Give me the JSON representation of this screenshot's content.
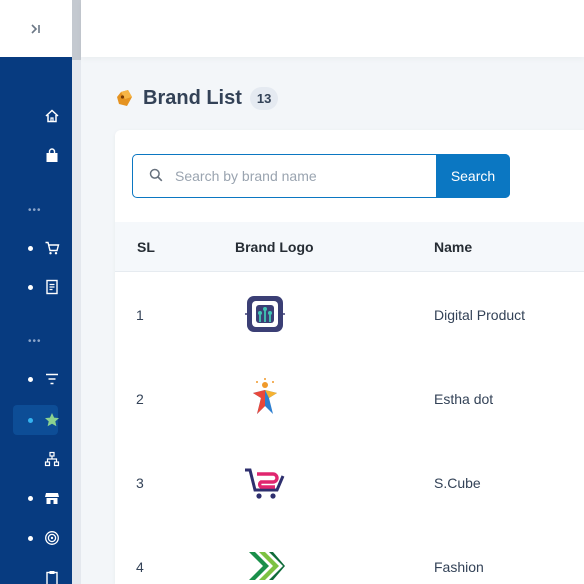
{
  "sidebar": {
    "collapse_icon": "collapse-right-icon",
    "items": [
      {
        "name": "home",
        "icon": "home-icon",
        "active": false
      },
      {
        "name": "bag",
        "icon": "bag-icon",
        "active": false
      },
      {
        "name": "cart",
        "icon": "cart-icon",
        "active": false
      },
      {
        "name": "orders",
        "icon": "document-icon",
        "active": false
      },
      {
        "name": "filter",
        "icon": "filter-icon",
        "active": false
      },
      {
        "name": "brands",
        "icon": "star-icon",
        "active": true
      },
      {
        "name": "categories",
        "icon": "hierarchy-icon",
        "active": false
      },
      {
        "name": "store",
        "icon": "store-icon",
        "active": false
      },
      {
        "name": "wireless",
        "icon": "wireless-icon",
        "active": false
      },
      {
        "name": "clipboard",
        "icon": "clipboard-icon",
        "active": false
      }
    ],
    "separator": "•••"
  },
  "page": {
    "title": "Brand List",
    "count": "13"
  },
  "search": {
    "placeholder": "Search by brand name",
    "value": "",
    "button_label": "Search"
  },
  "table": {
    "headers": [
      "SL",
      "Brand Logo",
      "Name"
    ],
    "rows": [
      {
        "sl": "1",
        "name": "Digital Product",
        "logo": "digital-product-logo"
      },
      {
        "sl": "2",
        "name": "Estha dot",
        "logo": "estha-dot-logo"
      },
      {
        "sl": "3",
        "name": "S.Cube",
        "logo": "s-cube-logo"
      },
      {
        "sl": "4",
        "name": "Fashion",
        "logo": "fashion-logo"
      }
    ]
  },
  "colors": {
    "sidebar_bg": "#073b80",
    "accent": "#0b77c2",
    "title_text": "#334257"
  }
}
